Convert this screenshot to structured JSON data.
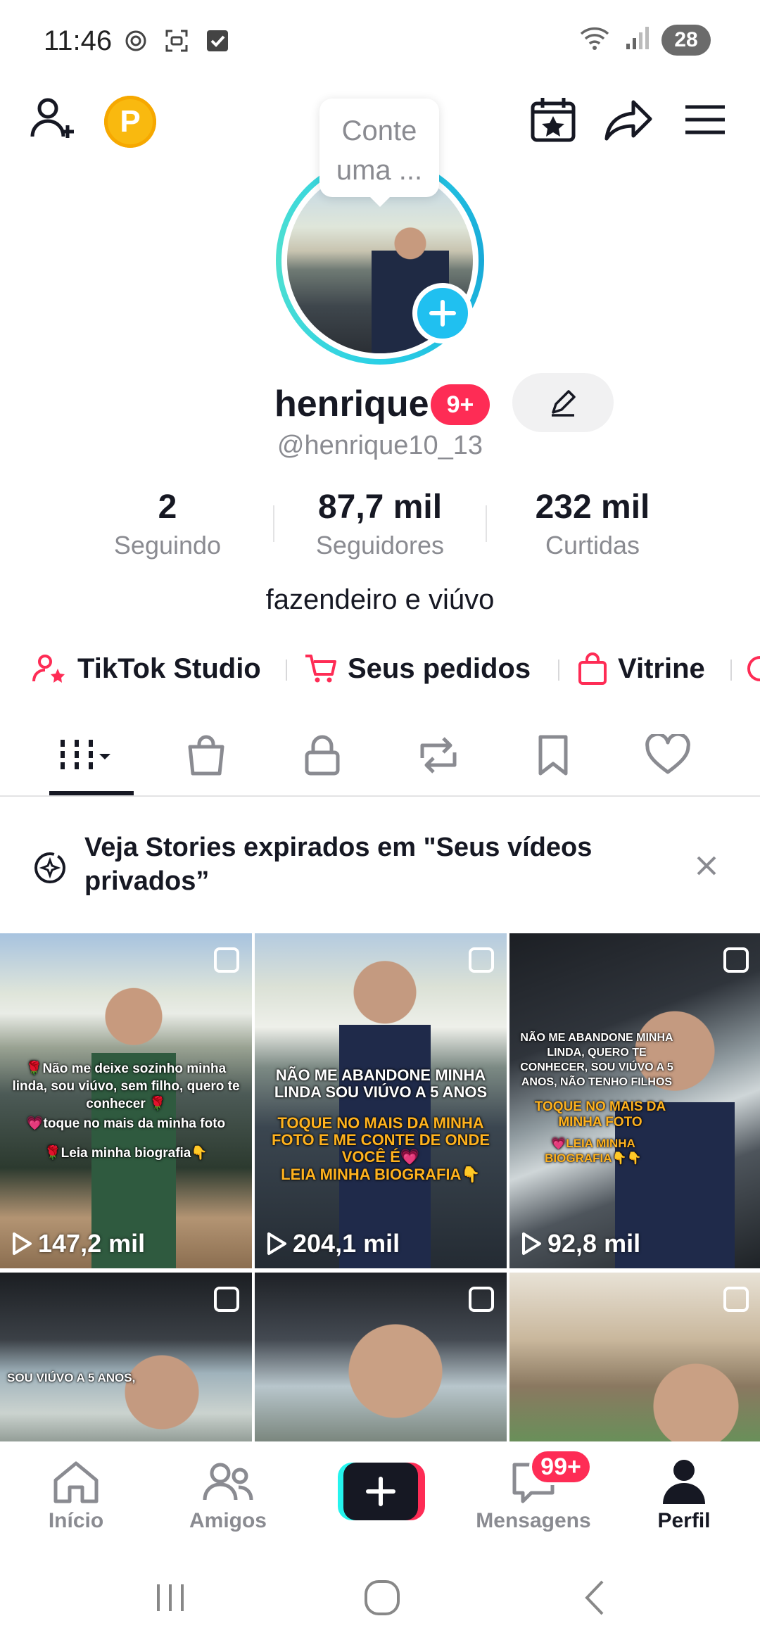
{
  "status_bar": {
    "time": "11:46",
    "battery": "28"
  },
  "profile": {
    "tooltip": "Conte uma ...",
    "name": "henrique",
    "name_badge": "9+",
    "handle": "@henrique10_13",
    "bio": "fazendeiro e viúvo",
    "coin_letter": "P"
  },
  "stats": [
    {
      "value": "2",
      "label": "Seguindo"
    },
    {
      "value": "87,7 mil",
      "label": "Seguidores"
    },
    {
      "value": "232 mil",
      "label": "Curtidas"
    }
  ],
  "links": [
    {
      "label": "TikTok Studio",
      "icon": "person-star-icon"
    },
    {
      "label": "Seus pedidos",
      "icon": "cart-icon"
    },
    {
      "label": "Vitrine",
      "icon": "shopping-bag-icon"
    }
  ],
  "tabs": [
    "videos-grid",
    "shop",
    "private",
    "reposts",
    "favorites",
    "liked"
  ],
  "banner": {
    "text": "Veja Stories expirados em \"Seus vídeos privados”"
  },
  "videos": [
    {
      "views": "147,2 mil",
      "captions": [
        "🌹Não me deixe sozinho minha linda, sou viúvo, sem filho, quero te conhecer 🌹",
        "💗toque no mais da minha foto",
        "🌹Leia minha biografia👇"
      ]
    },
    {
      "views": "204,1 mil",
      "captions": [
        "NÃO ME ABANDONE MINHA LINDA SOU VIÚVO A 5 ANOS",
        "TOQUE NO MAIS DA MINHA FOTO E ME CONTE DE ONDE VOCÊ É💗",
        "LEIA MINHA BIOGRAFIA👇"
      ]
    },
    {
      "views": "92,8 mil",
      "captions": [
        "NÃO ME ABANDONE MINHA LINDA, QUERO TE CONHECER, SOU VIÚVO A 5 ANOS, NÃO TENHO FILHOS",
        "TOQUE NO MAIS DA MINHA FOTO",
        "💗LEIA MINHA BIOGRAFIA👇👇"
      ]
    },
    {
      "views": "",
      "captions": [
        "SOU VIÚVO A 5 ANOS,"
      ]
    },
    {
      "views": "",
      "captions": []
    },
    {
      "views": "",
      "captions": []
    }
  ],
  "bottom_nav": {
    "home": "Início",
    "friends": "Amigos",
    "messages": "Mensagens",
    "messages_badge": "99+",
    "profile": "Perfil"
  },
  "colors": {
    "accent_red": "#fe2c55",
    "accent_cyan": "#25f4ee",
    "ring": "#20c0f0",
    "coin": "#f9b90f"
  }
}
